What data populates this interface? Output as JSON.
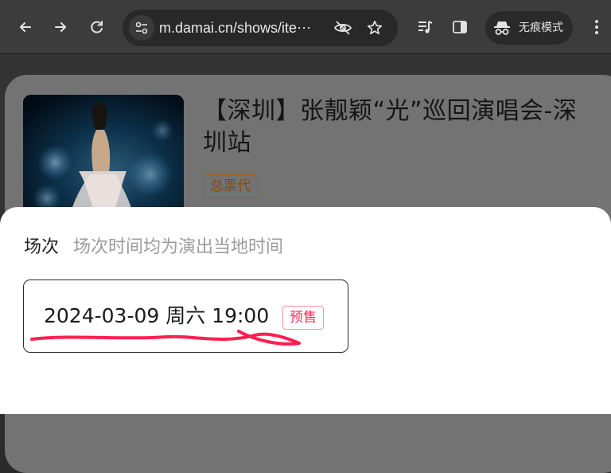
{
  "browser": {
    "url": "m.damai.cn/shows/ite⋯",
    "incognito_label": "无痕模式",
    "icons": [
      "back-icon",
      "forward-icon",
      "reload-icon",
      "site-info-icon",
      "eye-off-icon",
      "star-icon",
      "media-list-icon",
      "side-panel-icon",
      "incognito-icon",
      "more-icon"
    ]
  },
  "show": {
    "title": "【深圳】张靓颖“光”巡回演唱会-深圳站",
    "badge": "总票代"
  },
  "session_sheet": {
    "title": "场次",
    "note": "场次时间均为演出当地时间",
    "sessions": [
      {
        "datetime": "2024-03-09 周六 19:00",
        "tag": "预售"
      }
    ]
  },
  "colors": {
    "toolbar": "#3c3c3c",
    "presale": "#ff2a5a",
    "annotation": "#ff1f4f"
  }
}
